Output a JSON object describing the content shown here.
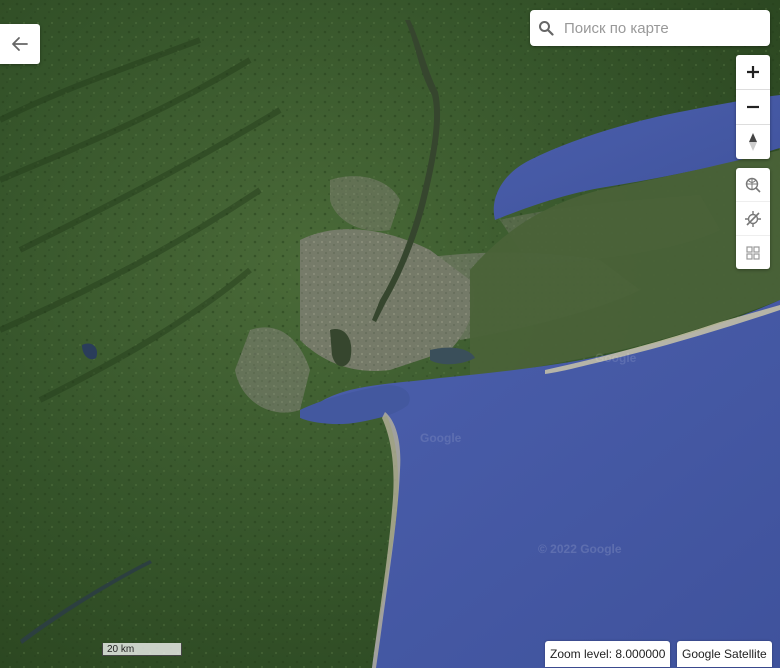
{
  "search": {
    "placeholder": "Поиск по карте"
  },
  "map": {
    "copyright": "© 2022 Google",
    "watermark": "Google",
    "scale_label": "20 km",
    "zoom_level_text": "Zoom level: 8.000000",
    "layer_name": "Google Satellite"
  },
  "controls": {
    "back_icon": "arrow-left-icon",
    "zoom_in_icon": "plus-icon",
    "zoom_out_icon": "minus-icon",
    "compass_icon": "compass-icon",
    "tools": [
      "geo-search-icon",
      "location-off-icon",
      "grid-icon"
    ]
  },
  "colors": {
    "land": "#3a5a2c",
    "urban": "#8a8a7e",
    "water": "#4257a0",
    "control_bg": "#ffffff"
  }
}
